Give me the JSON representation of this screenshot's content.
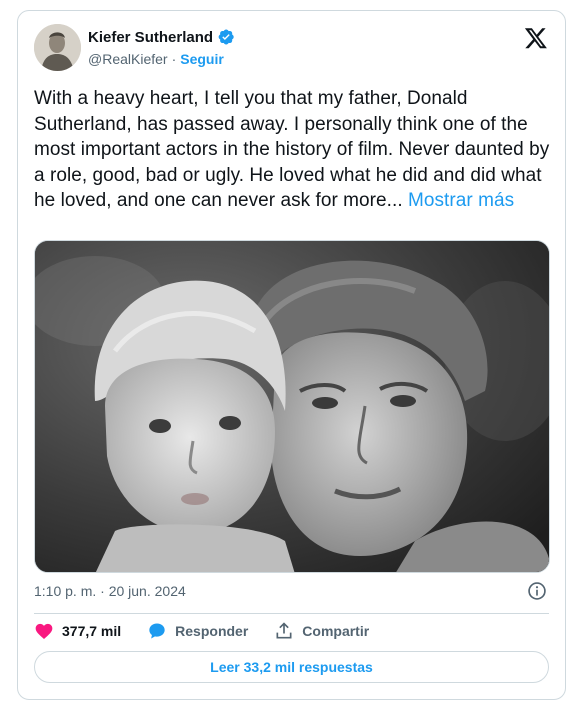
{
  "author": {
    "name": "Kiefer Sutherland",
    "handle": "@RealKiefer",
    "separator": "·",
    "follow_label": "Seguir",
    "verified": true
  },
  "tweet": {
    "text": "With a heavy heart, I tell you that my father, Donald Sutherland, has passed away. I personally think one of the most important actors in the history of film. Never daunted by a role, good, bad or ugly. He loved what he did and did what he loved, and one can never ask for more...",
    "show_more_label": "Mostrar más",
    "timestamp": "1:10 p. m. · 20 jun. 2024"
  },
  "actions": {
    "likes": "377,7 mil",
    "reply_label": "Responder",
    "share_label": "Compartir"
  },
  "read_replies_label": "Leer 33,2 mil respuestas",
  "icons": {
    "brand": "x-logo-icon",
    "verified": "verified-badge-icon",
    "info": "info-icon",
    "like": "heart-icon",
    "reply": "speech-bubble-icon",
    "share": "share-icon"
  },
  "colors": {
    "accent": "#1d9bf0",
    "like": "#f91880",
    "text": "#0f1419",
    "muted": "#536471",
    "border": "#cfd9de"
  }
}
